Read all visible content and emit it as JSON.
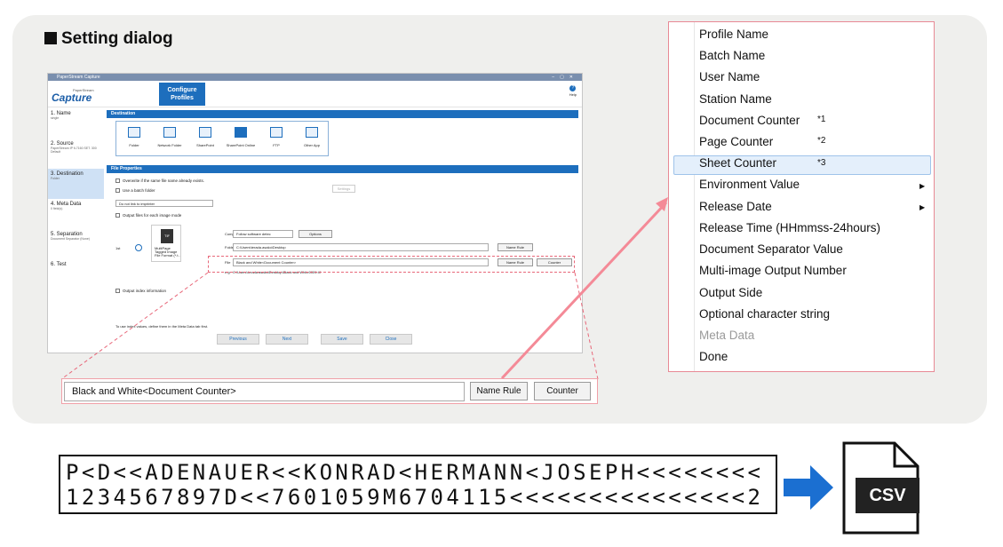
{
  "section_title": "Setting dialog",
  "app": {
    "window_title": "PaperStream Capture",
    "logo": "Capture",
    "logo_small": "PaperStream",
    "configure_label": "Configure Profiles",
    "help_label": "Help",
    "sidebar": [
      {
        "label": "1. Name",
        "sub": "single"
      },
      {
        "label": "2. Source",
        "sub": "PaperStream IP fi-7160 SET. 300 Default"
      },
      {
        "label": "3. Destination",
        "sub": "Folder"
      },
      {
        "label": "4. Meta Data",
        "sub": "0 field(s)"
      },
      {
        "label": "5. Separation",
        "sub": "Document Separator (None)"
      },
      {
        "label": "6. Test",
        "sub": ""
      }
    ],
    "destination_band": "Destination",
    "destinations": [
      "Folder",
      "Network Folder",
      "SharePoint",
      "SharePoint Online",
      "FTP",
      "Other App"
    ],
    "settings_label": "Settings",
    "file_properties_band": "File Properties",
    "overwrite_label": "Overwrite if the same file name already exists.",
    "batch_folder_label": "Use a batch folder",
    "imprinter_select": "Do not link to imprinter",
    "output_files_label": "Output files for each image mode",
    "first_label": "1st",
    "compression_label": "Compression",
    "compression_value": "Follow software detec",
    "options_label": "Options",
    "file_format_label": "MultiPage Tagged Image File Format (*.t..",
    "folder_label": "Folder",
    "folder_value": "C:\\Users\\terada.asako\\Desktop",
    "name_rule_label": "Name Rule",
    "file_label": "File",
    "file_value": "Black and White<Document Counter>",
    "counter_label": "Counter",
    "eg_label": "e.g.",
    "eg_value": "C:\\Users\\terada.asako\\Desktop\\Black and White0001.tif",
    "output_index_label": "Output index information",
    "hint_text": "To use index values, define them in the Meta Data tab first.",
    "previous_label": "Previous",
    "next_label": "Next",
    "save_label": "Save",
    "close_label": "Close"
  },
  "zoom_bar": {
    "file_value": "Black and White<Document Counter>",
    "name_rule_label": "Name Rule",
    "counter_label": "Counter"
  },
  "menu": {
    "items": [
      {
        "label": "Profile Name"
      },
      {
        "label": "Batch Name"
      },
      {
        "label": "User Name"
      },
      {
        "label": "Station Name"
      },
      {
        "label": "Document Counter",
        "note": "*1"
      },
      {
        "label": "Page Counter",
        "note": "*2"
      },
      {
        "label": "Sheet Counter",
        "note": "*3"
      },
      {
        "label": "Environment Value"
      },
      {
        "label": "Release Date"
      },
      {
        "label": "Release Time (HHmmss-24hours)"
      },
      {
        "label": "Document Separator Value"
      },
      {
        "label": "Multi-image Output Number"
      },
      {
        "label": "Output Side"
      },
      {
        "label": "Optional character string"
      },
      {
        "label": "Meta Data"
      },
      {
        "label": "Done"
      }
    ],
    "highlighted": "Sheet Counter"
  },
  "mrz": {
    "line1": "P<D<<ADENAUER<<KONRAD<HERMANN<JOSEPH<<<<<<<<",
    "line2": "1234567897D<<7601059M6704115<<<<<<<<<<<<<<<2"
  },
  "file_badge": "CSV",
  "colors": {
    "accent": "#1d6ebd",
    "highlight": "#e8687a",
    "arrow_blue": "#1b6fd1"
  }
}
